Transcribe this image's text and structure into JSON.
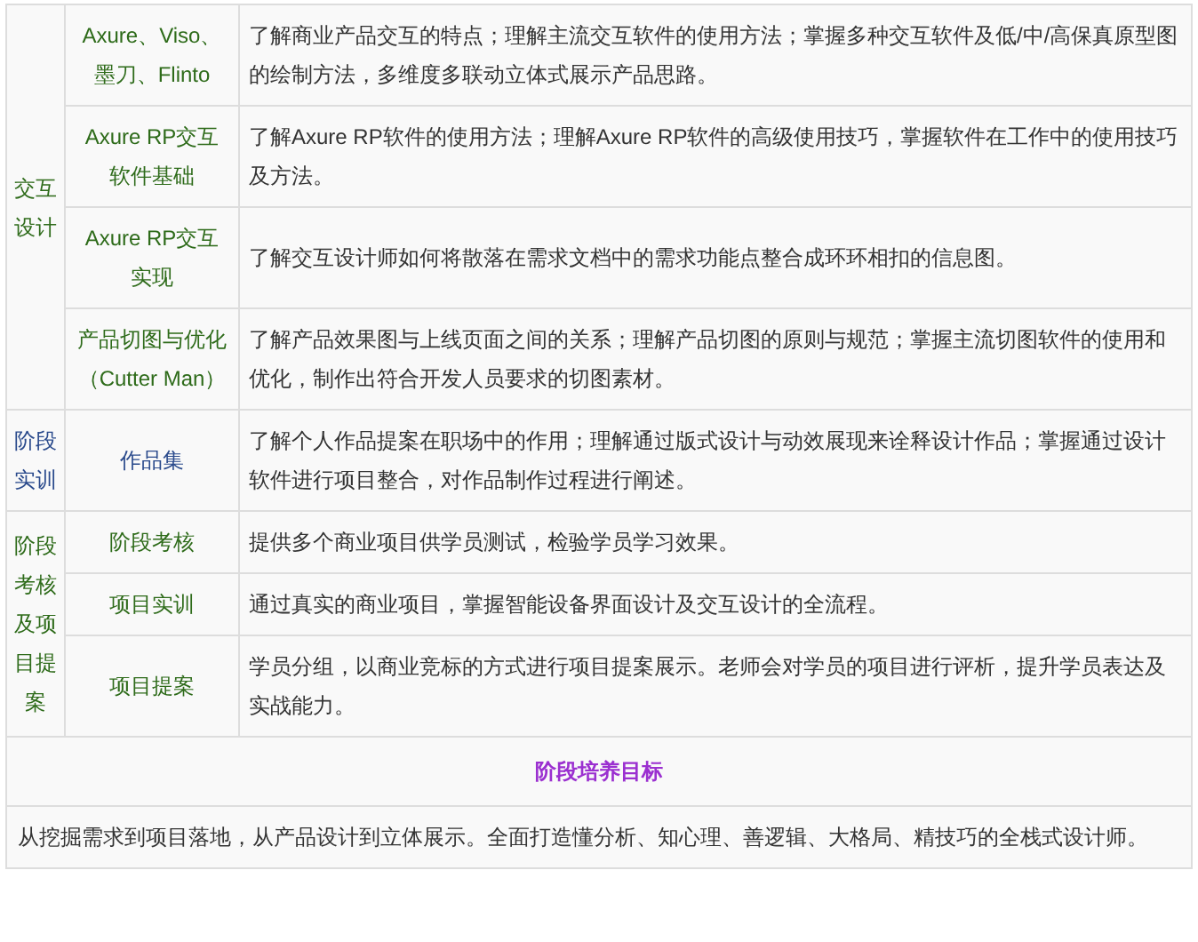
{
  "groups": [
    {
      "label": "交互设计",
      "color": "#2e6b1a",
      "items": [
        {
          "name": "Axure、Viso、墨刀、Flinto",
          "description": "了解商业产品交互的特点；理解主流交互软件的使用方法；掌握多种交互软件及低/中/高保真原型图的绘制方法，多维度多联动立体式展示产品思路。"
        },
        {
          "name": "Axure RP交互软件基础",
          "description": "了解Axure RP软件的使用方法；理解Axure RP软件的高级使用技巧，掌握软件在工作中的使用技巧及方法。"
        },
        {
          "name": "Axure RP交互实现",
          "description": "了解交互设计师如何将散落在需求文档中的需求功能点整合成环环相扣的信息图。"
        },
        {
          "name": "产品切图与优化（Cutter Man）",
          "description": "了解产品效果图与上线页面之间的关系；理解产品切图的原则与规范；掌握主流切图软件的使用和优化，制作出符合开发人员要求的切图素材。"
        }
      ]
    },
    {
      "label": "阶段实训",
      "color": "#2a4a8c",
      "items": [
        {
          "name": "作品集",
          "description": "了解个人作品提案在职场中的作用；理解通过版式设计与动效展现来诠释设计作品；掌握通过设计软件进行项目整合，对作品制作过程进行阐述。"
        }
      ]
    },
    {
      "label": "阶段考核及项目提案",
      "color": "#2e6b1a",
      "items": [
        {
          "name": "阶段考核",
          "description": "提供多个商业项目供学员测试，检验学员学习效果。"
        },
        {
          "name": "项目实训",
          "description": "通过真实的商业项目，掌握智能设备界面设计及交互设计的全流程。"
        },
        {
          "name": "项目提案",
          "description": "学员分组，以商业竞标的方式进行项目提案展示。老师会对学员的项目进行评析，提升学员表达及实战能力。"
        }
      ]
    }
  ],
  "goal": {
    "heading": "阶段培养目标",
    "text": "从挖掘需求到项目落地，从产品设计到立体展示。全面打造懂分析、知心理、善逻辑、大格局、精技巧的全栈式设计师。"
  }
}
